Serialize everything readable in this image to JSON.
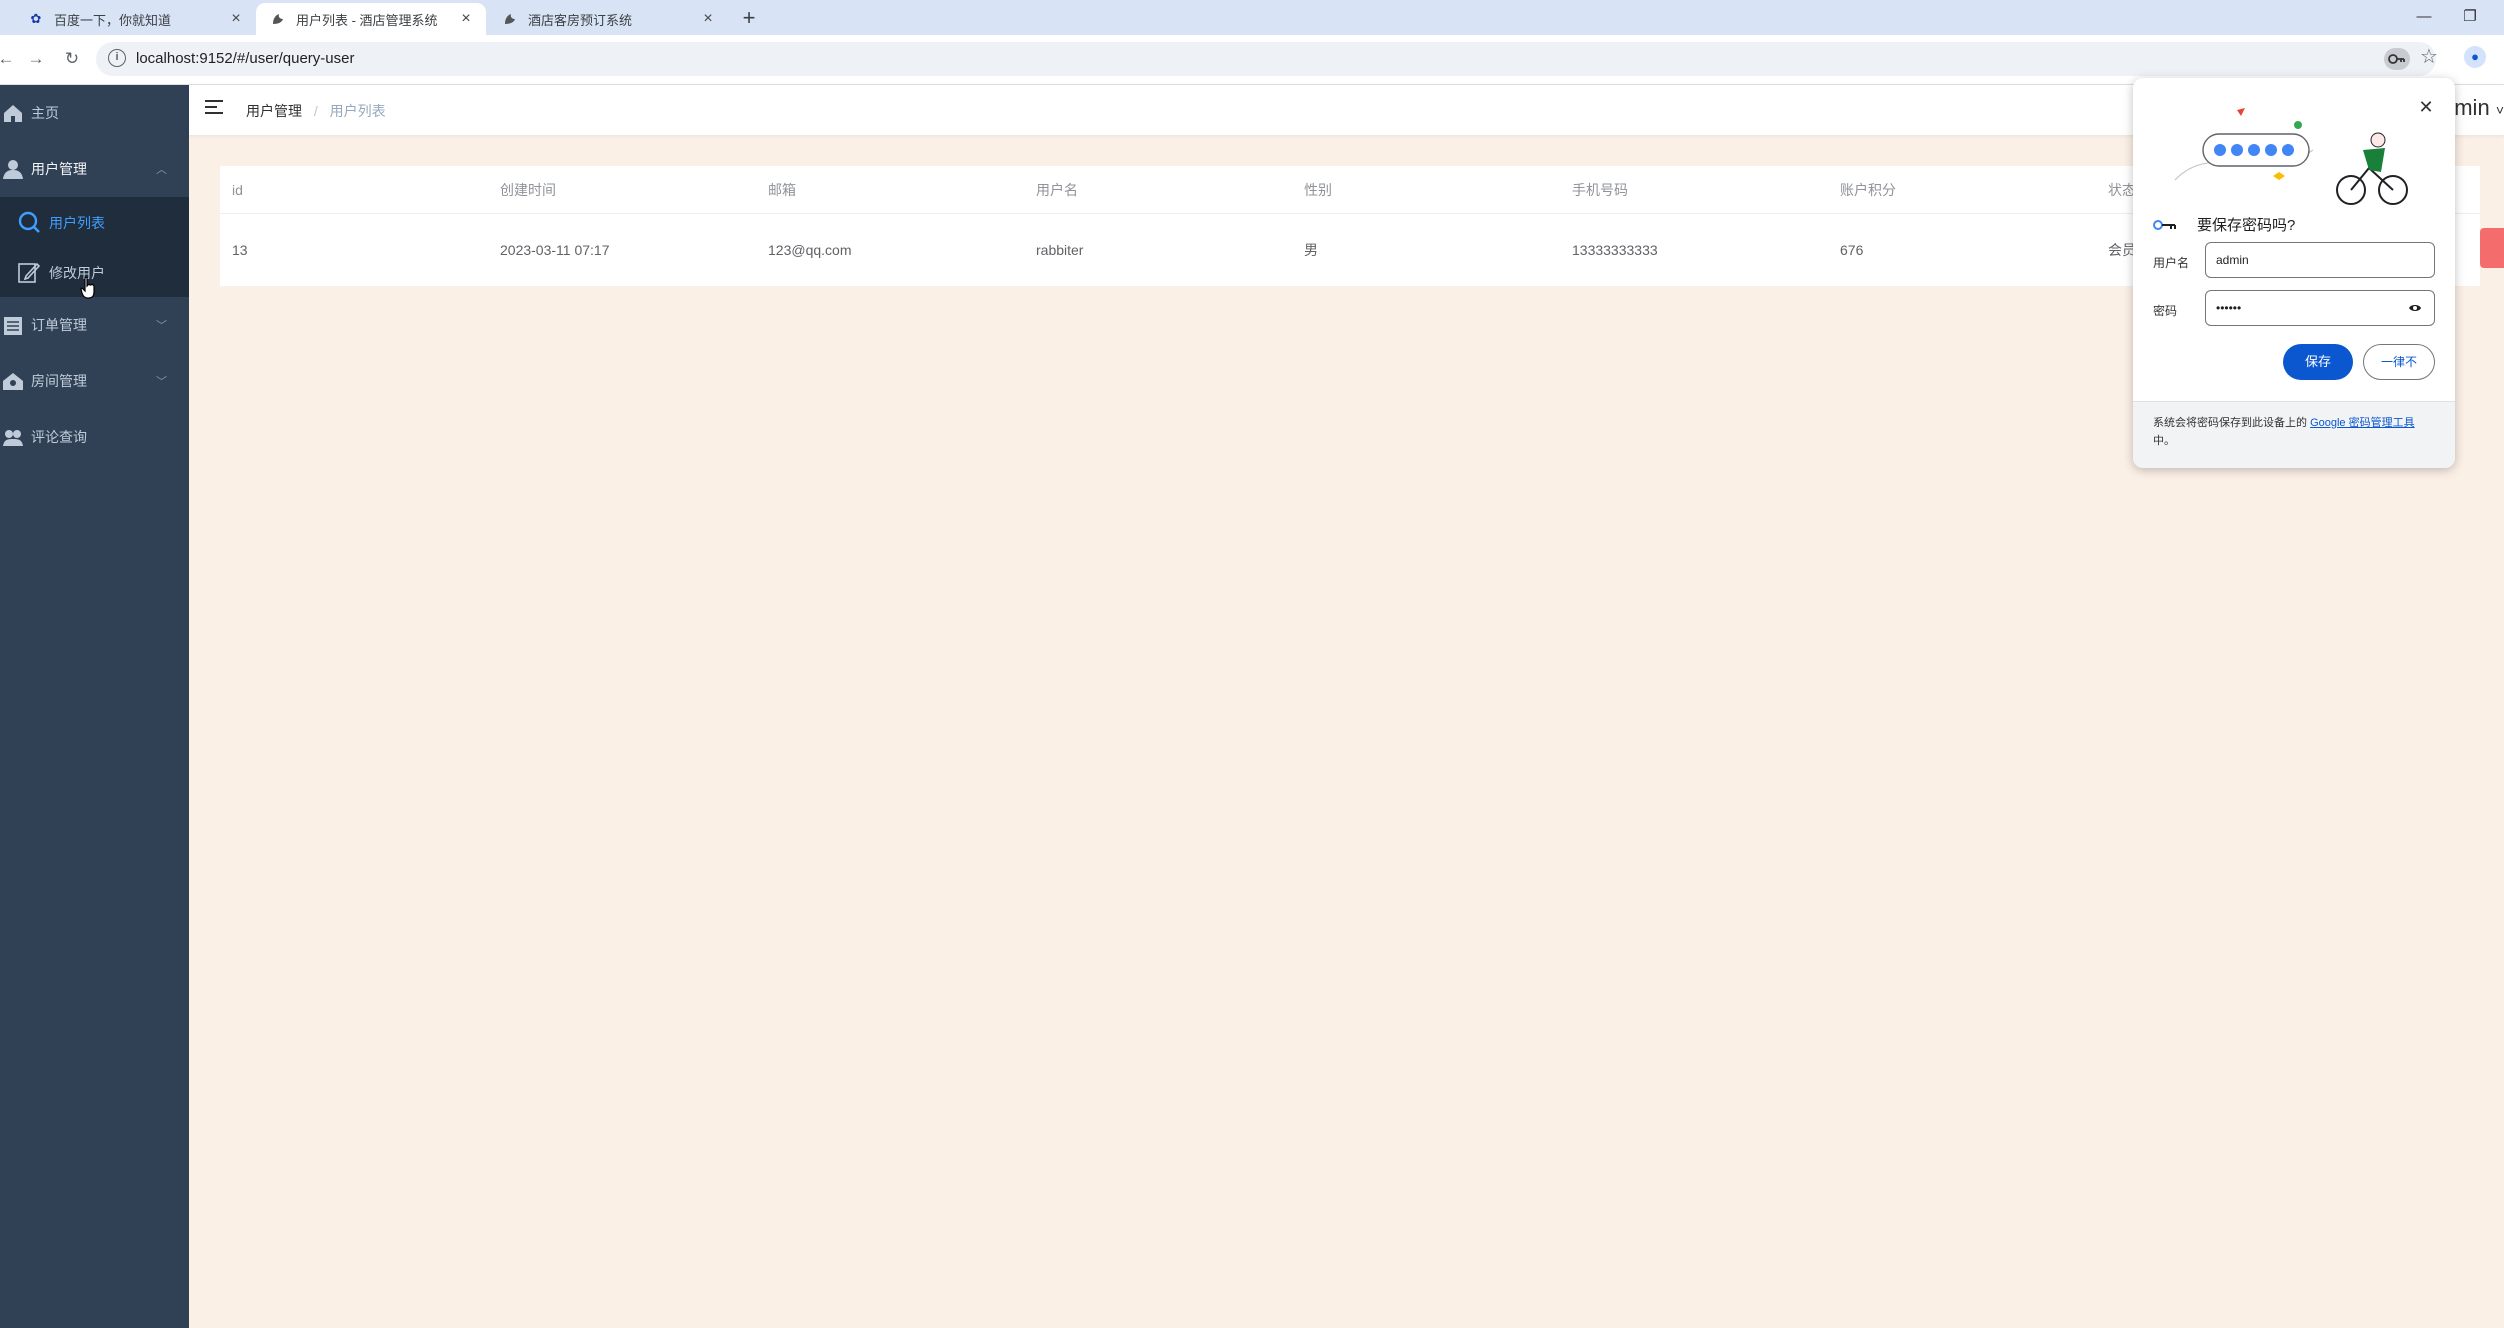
{
  "browser": {
    "tabs": [
      {
        "title": "百度一下，你就知道",
        "icon": "baidu-paw-icon",
        "active": false
      },
      {
        "title": "用户列表 - 酒店管理系统",
        "icon": "vue-admin-icon",
        "active": true
      },
      {
        "title": "酒店客房预订系统",
        "icon": "vue-admin-icon",
        "active": false
      }
    ],
    "url": "localhost:9152/#/user/query-user"
  },
  "sidebar": {
    "items": [
      {
        "label": "主页",
        "icon": "home-icon"
      },
      {
        "label": "用户管理",
        "icon": "user-icon",
        "expanded": true
      },
      {
        "label": "订单管理",
        "icon": "order-icon"
      },
      {
        "label": "房间管理",
        "icon": "room-icon"
      },
      {
        "label": "评论查询",
        "icon": "comment-icon"
      }
    ],
    "submenu": [
      {
        "label": "用户列表",
        "icon": "search-icon",
        "active": true
      },
      {
        "label": "修改用户",
        "icon": "edit-icon",
        "active": false
      }
    ]
  },
  "header": {
    "breadcrumb": [
      "用户管理",
      "用户列表"
    ],
    "username": "min"
  },
  "table": {
    "columns": [
      "id",
      "创建时间",
      "邮箱",
      "用户名",
      "性别",
      "手机号码",
      "账户积分",
      "状态"
    ],
    "rows": [
      [
        "13",
        "2023-03-11 07:17",
        "123@qq.com",
        "rabbiter",
        "男",
        "13333333333",
        "676",
        "会员"
      ]
    ]
  },
  "password_popup": {
    "title": "要保存密码吗?",
    "username_label": "用户名",
    "username_value": "admin",
    "password_label": "密码",
    "password_value": "••••••",
    "save_label": "保存",
    "never_label": "一律不",
    "footer_text": "系统会将密码保存到此设备上的",
    "footer_link": "Google 密码管理工具",
    "footer_suffix": "中。"
  },
  "colors": {
    "sidebar_bg": "#304156",
    "submenu_bg": "#1f2d3d",
    "active_blue": "#409eff",
    "page_bg": "#fbf0e6",
    "danger": "#f56c6c",
    "google_blue": "#0b57d0"
  }
}
